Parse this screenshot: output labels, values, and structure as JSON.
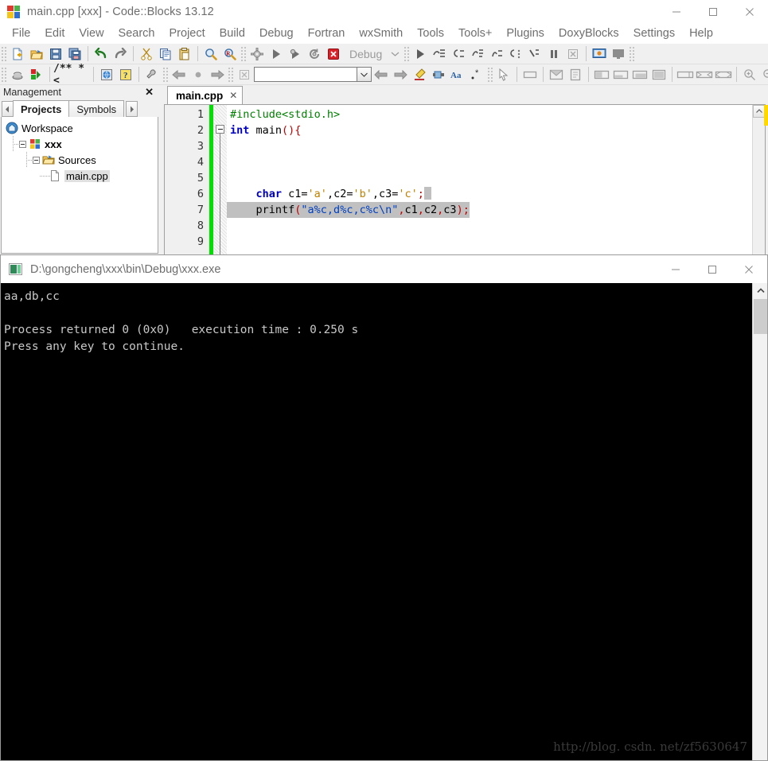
{
  "ide": {
    "title": "main.cpp [xxx] - Code::Blocks 13.12",
    "window_controls": {
      "minimize": "minimize-icon",
      "maximize": "maximize-icon",
      "close": "close-icon"
    },
    "menus": [
      "File",
      "Edit",
      "View",
      "Search",
      "Project",
      "Build",
      "Debug",
      "Fortran",
      "wxSmith",
      "Tools",
      "Tools+",
      "Plugins",
      "DoxyBlocks",
      "Settings",
      "Help"
    ],
    "toolbar_row1": [
      "new-file-icon",
      "open-file-icon",
      "save-icon",
      "save-all-icon",
      "undo-icon",
      "redo-icon",
      "cut-icon",
      "copy-icon",
      "paste-icon",
      "find-icon",
      "replace-icon",
      "build-icon",
      "run-icon",
      "build-and-run-icon",
      "rebuild-icon",
      "abort-icon"
    ],
    "build_target": "Debug",
    "toolbar_row1b": [
      "debug-continue-icon",
      "debug-run-to-cursor-icon",
      "debug-next-line-icon",
      "debug-step-into-icon",
      "debug-step-out-icon",
      "debug-next-instruction-icon",
      "debug-step-into-instruction-icon",
      "debug-break-icon",
      "debug-stop-icon",
      "debugging-windows-icon",
      "various-info-icon"
    ],
    "toolbar_row2": [
      "compiler-icon",
      "debugger-icon",
      "doxyblocks-comment-icon",
      "doxyblocks-run-icon",
      "doxyblocks-help-icon",
      "doxyblocks-settings-icon",
      "nav-back-icon",
      "nav-bookmark-icon",
      "nav-forward-icon",
      "clear-search-icon"
    ],
    "search_value": "",
    "search_placeholder": "",
    "toolbar_row2b": [
      "prev-icon",
      "next-icon",
      "highlight-icon",
      "selection-icon",
      "match-case-icon",
      "regex-icon",
      "pointer-icon",
      "panel-icon",
      "dialog-icon",
      "frame-icon",
      "align-left-icon",
      "align-bottom-icon",
      "align-right-icon",
      "align-fill-icon",
      "expand-h-icon",
      "shrink-icon",
      "expand-icon",
      "zoom-in-icon",
      "zoom-out-icon"
    ]
  },
  "management": {
    "title": "Management",
    "close_label": "✕",
    "tabs": [
      {
        "label": "Projects",
        "active": true
      },
      {
        "label": "Symbols",
        "active": false
      }
    ],
    "left_arrow": "chevron-left-icon",
    "right_arrow": "chevron-right-icon",
    "tree": {
      "workspace": "Workspace",
      "project": "xxx",
      "folder": "Sources",
      "file": "main.cpp"
    }
  },
  "editor": {
    "tab_label": "main.cpp",
    "tab_close": "✕",
    "line_numbers": [
      "1",
      "2",
      "3",
      "4",
      "5",
      "6",
      "7",
      "8",
      "9"
    ],
    "lines": [
      "#include<stdio.h>",
      "int main(){",
      "",
      "",
      "",
      "    char c1='a',c2='b',c3='c';",
      "    printf(\"a%c,d%c,c%c\\n\",c1,c2,c3);",
      "",
      ""
    ],
    "colors": {
      "preprocessor": "#008000",
      "keyword": "#0000c0",
      "string": "#0040c0",
      "character": "#c08000",
      "operator": "#c00000",
      "change_bar": "#00e000",
      "highlight": "#c0c0c0"
    }
  },
  "console": {
    "title": "D:\\gongcheng\\xxx\\bin\\Debug\\xxx.exe",
    "window_controls": {
      "minimize": "minimize-icon",
      "maximize": "maximize-icon",
      "close": "close-icon"
    },
    "output": "aa,db,cc\n\nProcess returned 0 (0x0)   execution time : 0.250 s\nPress any key to continue.",
    "scroll_up": "chevron-up-icon"
  },
  "watermark": "http://blog. csdn. net/zf5630647"
}
